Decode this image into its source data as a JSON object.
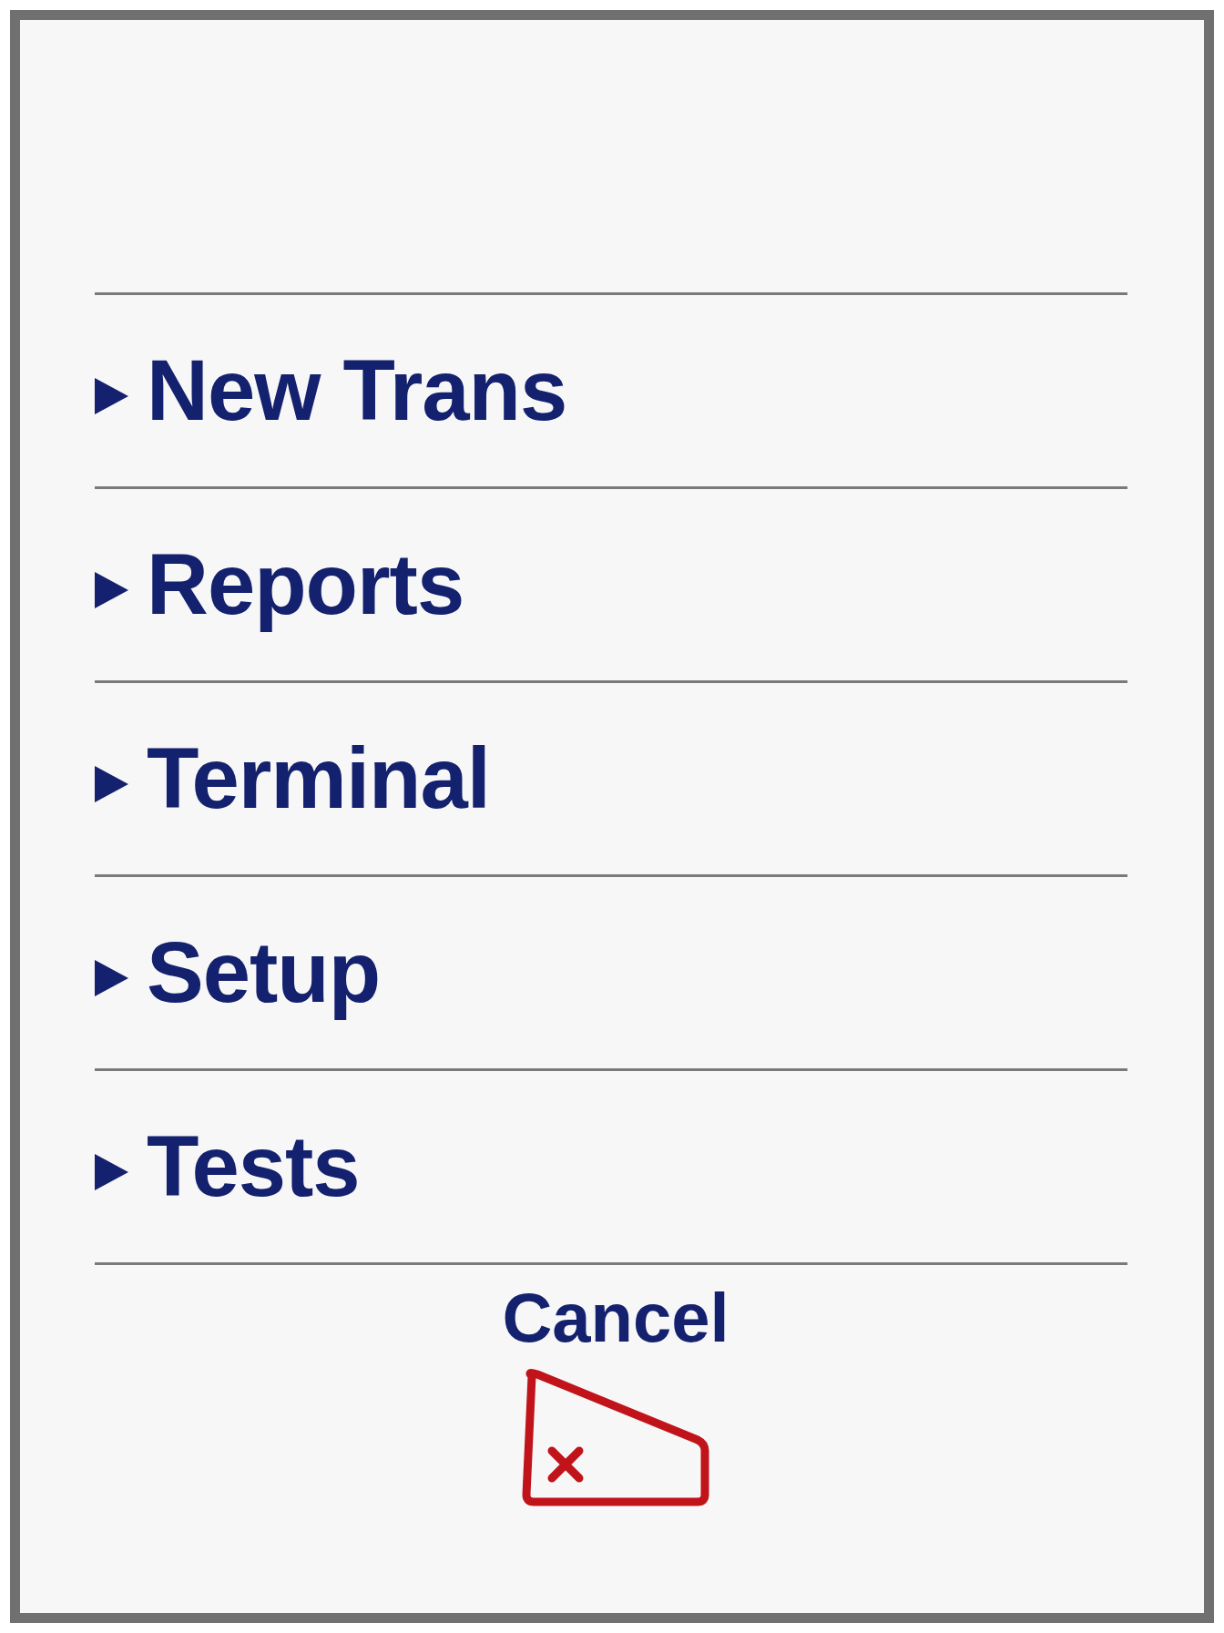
{
  "menu": {
    "items": [
      {
        "label": "New Trans"
      },
      {
        "label": "Reports"
      },
      {
        "label": "Terminal"
      },
      {
        "label": "Setup"
      },
      {
        "label": "Tests"
      }
    ]
  },
  "cancel": {
    "label": "Cancel"
  }
}
